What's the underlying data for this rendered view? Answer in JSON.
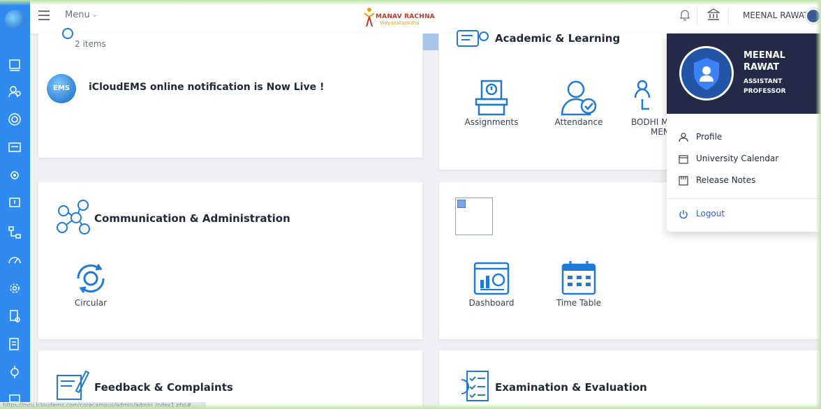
{
  "topbar": {
    "menu_label": "Menu",
    "brand_title": "MANAV RACHNA",
    "brand_subtitle": "Vidyanatariksha",
    "username": "MEENAL RAWAT"
  },
  "cards": {
    "notifications": {
      "items_count": "2 items",
      "notice": "iCloudEMS online notification is Now Live !",
      "notice_logo_text": "EMS"
    },
    "academic": {
      "title": "Academic & Learning",
      "tiles": [
        {
          "label": "Assignments"
        },
        {
          "label": "Attendance"
        },
        {
          "label": "BODHI M",
          "label2": "MEN"
        }
      ]
    },
    "communication": {
      "title": "Communication & Administration",
      "tiles": [
        {
          "label": "Circular"
        }
      ]
    },
    "reports": {
      "tiles": [
        {
          "label": "Dashboard"
        },
        {
          "label": "Time Table"
        }
      ]
    },
    "feedback": {
      "title": "Feedback & Complaints"
    },
    "examination": {
      "title": "Examination & Evaluation"
    }
  },
  "dropdown": {
    "name": "MEENAL RAWAT",
    "role": "ASSISTANT PROFESSOR",
    "items": [
      {
        "label": "Profile",
        "icon": "user-icon"
      },
      {
        "label": "University Calendar",
        "icon": "calendar-icon"
      },
      {
        "label": "Release Notes",
        "icon": "notes-icon"
      }
    ],
    "logout": "Logout"
  },
  "status_url": "https://mru.icloudems.com/corecampus/admin/admin_index1.php#",
  "colors": {
    "sidebar": "#2f8bf0",
    "accent": "#1e7ad6",
    "dropdown_header": "#232946",
    "logout": "#2563eb"
  }
}
